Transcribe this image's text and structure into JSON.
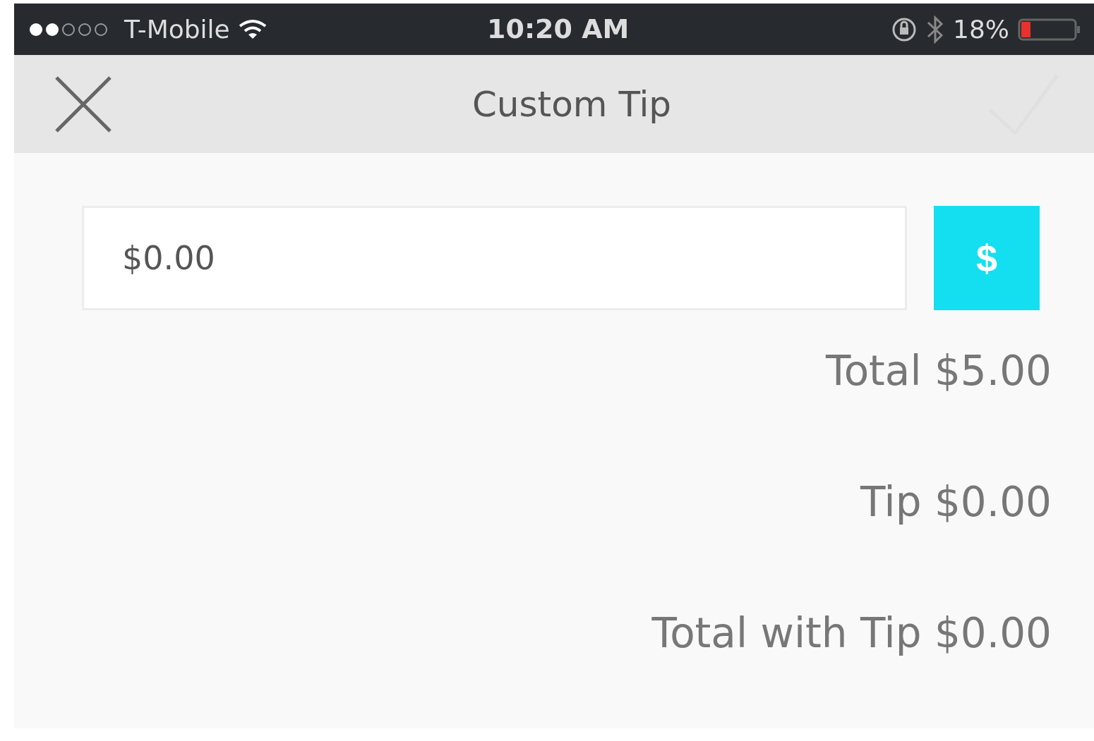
{
  "status_bar": {
    "carrier": "T-Mobile",
    "time": "10:20 AM",
    "battery": "18%"
  },
  "nav_bar": {
    "title": "Custom Tip",
    "done_disabled": true
  },
  "tip_field": {
    "value": "$0.00"
  },
  "currency_button": {
    "label": "$"
  },
  "summary": [
    {
      "text": "Total $5.00"
    },
    {
      "text": "Tip $0.00"
    },
    {
      "text": "Total with Tip $0.00"
    }
  ]
}
